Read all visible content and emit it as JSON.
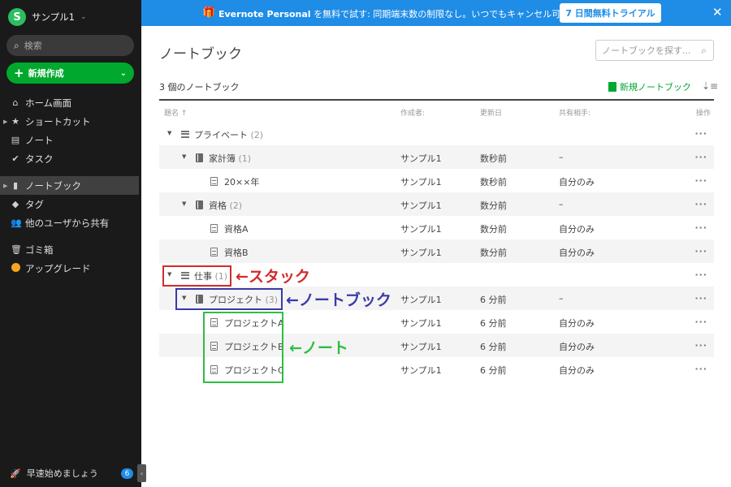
{
  "sidebar": {
    "account_initial": "S",
    "account_name": "サンプル1",
    "search_placeholder": "検索",
    "new_button": "新規作成",
    "items": [
      {
        "label": "ホーム画面",
        "icon": "home-icon"
      },
      {
        "label": "ショートカット",
        "icon": "star-icon"
      },
      {
        "label": "ノート",
        "icon": "note-icon"
      },
      {
        "label": "タスク",
        "icon": "check-circle-icon"
      },
      {
        "label": "ノートブック",
        "icon": "notebook-icon"
      },
      {
        "label": "タグ",
        "icon": "tag-icon"
      },
      {
        "label": "他のユーザから共有",
        "icon": "people-icon"
      },
      {
        "label": "ゴミ箱",
        "icon": "trash-icon"
      },
      {
        "label": "アップグレード",
        "icon": "upgrade-icon"
      }
    ],
    "footer_label": "早速始めましょう",
    "footer_badge": "6"
  },
  "banner": {
    "brand": "Evernote Personal",
    "text": " を無料で試す: 同期端末数の制限なし。いつでもキャンセル可能です。",
    "trial_button": "7 日間無料トライアル"
  },
  "main": {
    "title": "ノートブック",
    "search_placeholder": "ノートブックを探す...",
    "count_label": "3 個のノートブック",
    "new_notebook": "新規ノートブック",
    "columns": {
      "title": "題名 ↑",
      "author": "作成者:",
      "updated": "更新日",
      "shared": "共有相手:",
      "actions": "操作"
    },
    "rows": [
      {
        "name": "プライベート",
        "count": "(2)",
        "author": "",
        "updated": "",
        "shared": ""
      },
      {
        "name": "家計簿",
        "count": "(1)",
        "author": "サンプル1",
        "updated": "数秒前",
        "shared": "–"
      },
      {
        "name": "20××年",
        "count": "",
        "author": "サンプル1",
        "updated": "数秒前",
        "shared": "自分のみ"
      },
      {
        "name": "資格",
        "count": "(2)",
        "author": "サンプル1",
        "updated": "数分前",
        "shared": "–"
      },
      {
        "name": "資格A",
        "count": "",
        "author": "サンプル1",
        "updated": "数分前",
        "shared": "自分のみ"
      },
      {
        "name": "資格B",
        "count": "",
        "author": "サンプル1",
        "updated": "数分前",
        "shared": "自分のみ"
      },
      {
        "name": "仕事",
        "count": "(1)",
        "author": "",
        "updated": "",
        "shared": ""
      },
      {
        "name": "プロジェクト",
        "count": "(3)",
        "author": "サンプル1",
        "updated": "6 分前",
        "shared": "–"
      },
      {
        "name": "プロジェクトA",
        "count": "",
        "author": "サンプル1",
        "updated": "6 分前",
        "shared": "自分のみ"
      },
      {
        "name": "プロジェクトB",
        "count": "",
        "author": "サンプル1",
        "updated": "6 分前",
        "shared": "自分のみ"
      },
      {
        "name": "プロジェクトC",
        "count": "",
        "author": "サンプル1",
        "updated": "6 分前",
        "shared": "自分のみ"
      }
    ],
    "row_menu": "···"
  },
  "annotations": {
    "stack_label": "←スタック",
    "notebook_label": "←ノートブック",
    "note_label": "←ノート",
    "colors": {
      "stack": "#d42a2a",
      "notebook": "#3a3aa8",
      "note": "#2dbe44"
    }
  },
  "colors": {
    "banner": "#1f8ce6",
    "accent_green": "#00a82d",
    "sidebar_bg": "#1a1a1a"
  }
}
